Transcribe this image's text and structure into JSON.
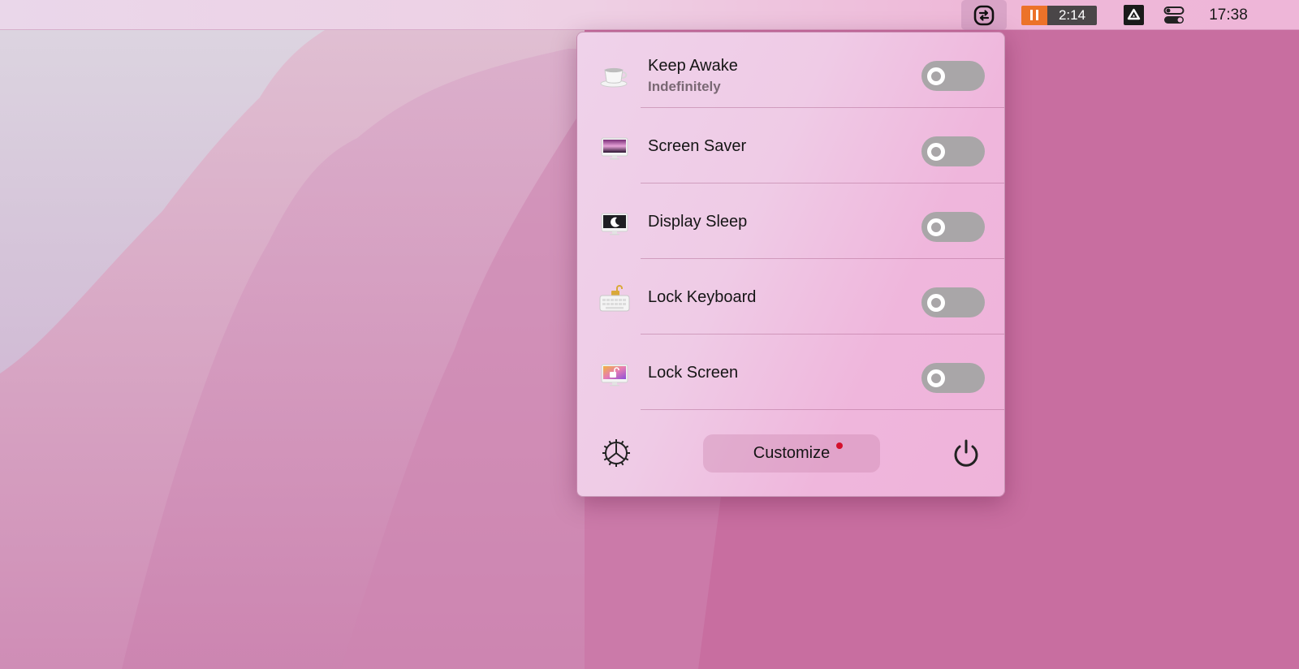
{
  "menubar": {
    "active_app_icon": "amphetamine-swap-icon",
    "timer": {
      "state_icon": "pause-icon",
      "time": "2:14",
      "accent_color": "#ec7229"
    },
    "drive_icon": "google-drive-icon",
    "control_center_icon": "control-center-toggles-icon",
    "clock": "17:38"
  },
  "popover": {
    "items": [
      {
        "id": "keep-awake",
        "icon": "coffee-cup-icon",
        "title": "Keep Awake",
        "subtitle": "Indefinitely",
        "enabled": false
      },
      {
        "id": "screen-saver",
        "icon": "screen-saver-monitor-icon",
        "title": "Screen Saver",
        "enabled": false
      },
      {
        "id": "display-sleep",
        "icon": "display-sleep-moon-icon",
        "title": "Display Sleep",
        "enabled": false
      },
      {
        "id": "lock-keyboard",
        "icon": "keyboard-lock-icon",
        "title": "Lock Keyboard",
        "enabled": false
      },
      {
        "id": "lock-screen",
        "icon": "screen-lock-icon",
        "title": "Lock Screen",
        "enabled": false
      }
    ],
    "footer": {
      "settings_icon": "gear-icon",
      "customize_label": "Customize",
      "customize_badge_color": "#d4102c",
      "power_icon": "power-icon"
    }
  }
}
